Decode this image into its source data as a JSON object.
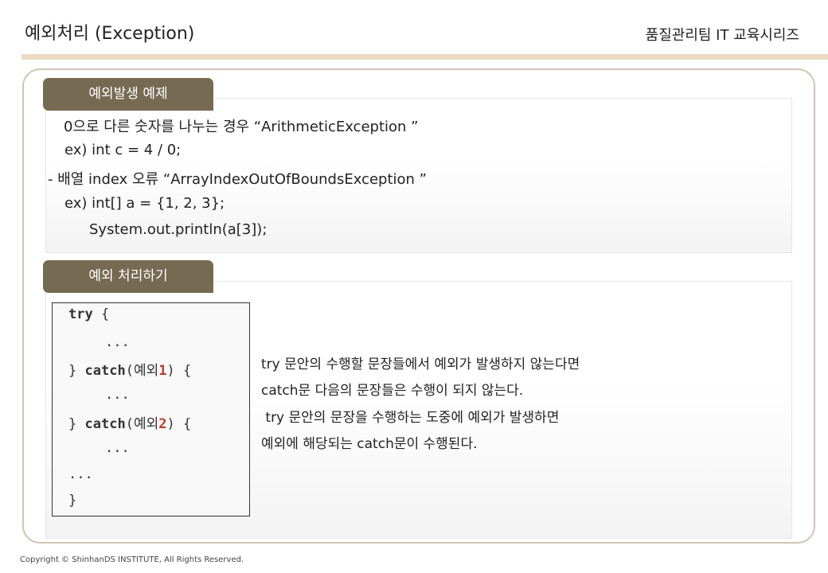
{
  "header": {
    "title": "예외처리 (Exception)",
    "series": "품질관리팀 IT 교육시리즈"
  },
  "section1": {
    "tab_label": "예외발생 예제",
    "lines": [
      "0으로 다른 숫자를 나누는 경우 “ArithmeticException ”",
      "ex) int c = 4 / 0;",
      "- 배열 index 오류 “ArrayIndexOutOfBoundsException ”",
      "ex) int[] a = {1, 2, 3};",
      "System.out.println(a[3]);"
    ]
  },
  "section2": {
    "tab_label": "예외 처리하기",
    "code": {
      "try": "try",
      "brace_open": "{",
      "ellipsis": "...",
      "close_brace": "}",
      "catch": "catch",
      "exception_word": "예외",
      "num1": "1",
      "num2": "2"
    },
    "description": [
      "try 문안의 수행할 문장들에서 예외가 발생하지 않는다면",
      "catch문 다음의 문장들은 수행이 되지 않는다.",
      " try 문안의 문장을 수행하는 도중에 예외가 발생하면",
      "예외에 해당되는 catch문이 수행된다."
    ]
  },
  "footer": {
    "copyright": "Copyright © ShinhanDS INSTITUTE, All Rights Reserved."
  }
}
